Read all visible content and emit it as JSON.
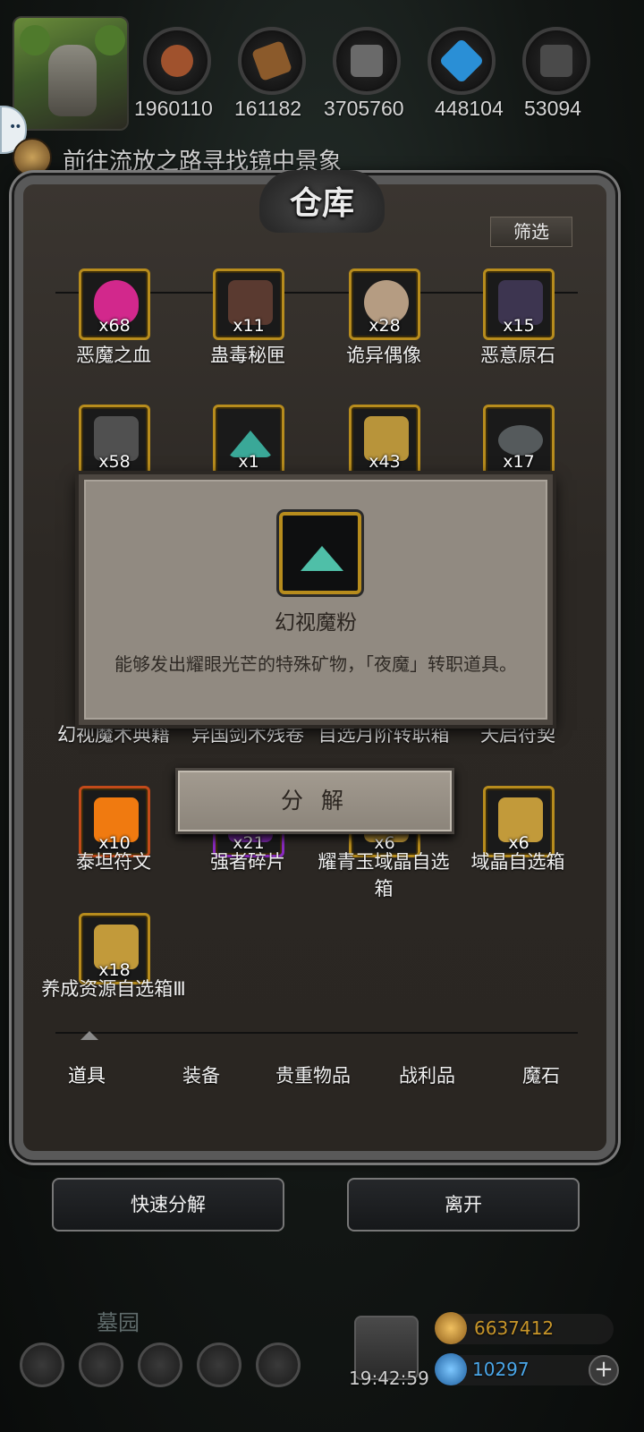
{
  "hud": {
    "resources": [
      {
        "icon": "meat-icon",
        "count": "1960110",
        "color": "#a0522d"
      },
      {
        "icon": "wood-icon",
        "count": "161182",
        "color": "#8b5a2b"
      },
      {
        "icon": "iron-icon",
        "count": "3705760",
        "color": "#5a5a5a"
      },
      {
        "icon": "crystal-icon",
        "count": "448104",
        "color": "#2a8fd6"
      },
      {
        "icon": "stone-icon",
        "count": "53094",
        "color": "#4a4a4a"
      }
    ],
    "quest_text": "前往流放之路寻找镜中景象"
  },
  "warehouse": {
    "title": "仓库",
    "filter_label": "筛选",
    "items": [
      {
        "name": "恶魔之血",
        "qty": "x68",
        "color": "#d2288c"
      },
      {
        "name": "蛊毒秘匣",
        "qty": "x11",
        "color": "#5a3a30"
      },
      {
        "name": "诡异偶像",
        "qty": "x28",
        "color": "#b59c82"
      },
      {
        "name": "恶意原石",
        "qty": "x15",
        "color": "#3d3550"
      },
      {
        "name": "",
        "qty": "x58",
        "color": "#505050"
      },
      {
        "name": "",
        "qty": "x1",
        "color": "#3aa898"
      },
      {
        "name": "",
        "qty": "x43",
        "color": "#b8943a"
      },
      {
        "name": "",
        "qty": "x17",
        "color": "#555a5c"
      },
      {
        "name": "幻视魔术典籍",
        "qty": "",
        "color": "#2a2a2a"
      },
      {
        "name": "异国剑术残卷",
        "qty": "",
        "color": "#2a2a2a"
      },
      {
        "name": "自选月阶转职箱",
        "qty": "",
        "color": "#2a2a2a"
      },
      {
        "name": "天启符契",
        "qty": "",
        "color": "#2a2a2a"
      },
      {
        "name": "泰坦符文",
        "qty": "x10",
        "color": "#f07a10"
      },
      {
        "name": "强者碎片",
        "qty": "x21",
        "color": "#7a2aa8"
      },
      {
        "name": "耀青玉域晶自选箱",
        "qty": "x6",
        "color": "#c29a3a"
      },
      {
        "name": "域晶自选箱",
        "qty": "x6",
        "color": "#c29a3a"
      },
      {
        "name": "养成资源自选箱Ⅲ",
        "qty": "x18",
        "color": "#c29a3a"
      }
    ],
    "tabs": [
      "道具",
      "装备",
      "贵重物品",
      "战利品",
      "魔石"
    ],
    "active_tab": "道具"
  },
  "popup": {
    "item_name": "幻视魔粉",
    "description": "能够发出耀眼光芒的特殊矿物，「夜魔」转职道具。",
    "decompose_label": "分 解"
  },
  "actions": {
    "quick_decompose": "快速分解",
    "leave": "离开"
  },
  "footer": {
    "area_label": "墓园",
    "time": "19:42:59",
    "gold": "6637412",
    "diamonds": "10297",
    "gold_color": "#c8962a",
    "diamond_color": "#2a8fd6"
  }
}
